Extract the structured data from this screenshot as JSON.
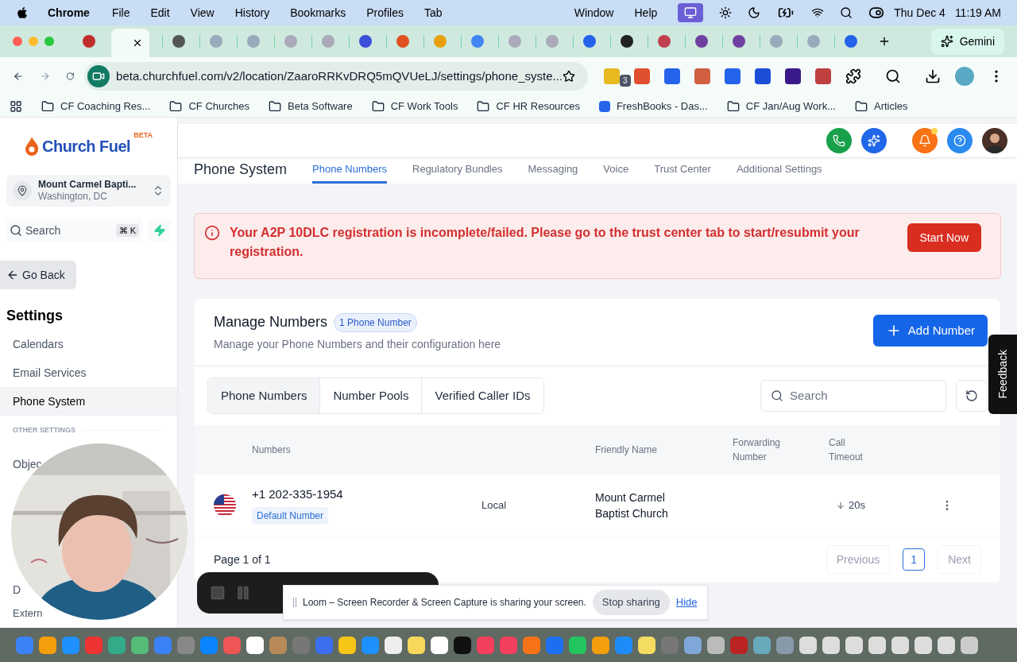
{
  "menu_bar": {
    "app": "Chrome",
    "menus": [
      "File",
      "Edit",
      "View",
      "History",
      "Bookmarks",
      "Profiles",
      "Tab"
    ],
    "right_menus": [
      "Window",
      "Help"
    ],
    "date": "Thu Dec 4",
    "time": "11:19 AM"
  },
  "browser": {
    "gemini": "Gemini",
    "url": "beta.churchfuel.com/v2/location/ZaaroRRKvDRQ5mQVUeLJ/settings/phone_syste...",
    "extension_badge": "3",
    "bookmarks": [
      {
        "label": "CF Coaching Res...",
        "kind": "folder"
      },
      {
        "label": "CF Churches",
        "kind": "folder"
      },
      {
        "label": "Beta Software",
        "kind": "folder"
      },
      {
        "label": "CF Work Tools",
        "kind": "folder"
      },
      {
        "label": "CF HR Resources",
        "kind": "folder"
      },
      {
        "label": "FreshBooks - Das...",
        "kind": "site"
      },
      {
        "label": "CF Jan/Aug Work...",
        "kind": "folder"
      },
      {
        "label": "Articles",
        "kind": "folder"
      }
    ]
  },
  "sidebar": {
    "logo": "Church Fuel",
    "logo_tag": "BETA",
    "location": {
      "name": "Mount Carmel Bapti...",
      "city": "Washington, DC"
    },
    "search": {
      "placeholder": "Search",
      "shortcut": "⌘ K"
    },
    "go_back": "Go Back",
    "heading": "Settings",
    "items": [
      {
        "label": "Calendars",
        "selected": false
      },
      {
        "label": "Email Services",
        "selected": false
      },
      {
        "label": "Phone System",
        "selected": true
      }
    ],
    "section": "OTHER SETTINGS",
    "other_items": [
      "Objec",
      "D",
      "Extern"
    ]
  },
  "page": {
    "title": "Phone System",
    "tabs": [
      {
        "label": "Phone Numbers",
        "selected": true
      },
      {
        "label": "Regulatory Bundles",
        "selected": false
      },
      {
        "label": "Messaging",
        "selected": false
      },
      {
        "label": "Voice",
        "selected": false
      },
      {
        "label": "Trust Center",
        "selected": false
      },
      {
        "label": "Additional Settings",
        "selected": false
      }
    ],
    "alert": {
      "message": "Your A2P 10DLC registration is incomplete/failed. Please go to the trust center tab to start/resubmit your registration.",
      "action": "Start Now"
    },
    "card": {
      "title": "Manage Numbers",
      "count": "1 Phone Number",
      "subtitle": "Manage your Phone Numbers and their configuration here",
      "add_button": "Add Number",
      "segments": [
        {
          "label": "Phone Numbers",
          "selected": true
        },
        {
          "label": "Number Pools",
          "selected": false
        },
        {
          "label": "Verified Caller IDs",
          "selected": false
        }
      ],
      "search": {
        "placeholder": "Search"
      },
      "columns": [
        "Numbers",
        "Friendly Name",
        "Forwarding Number",
        "Call Timeout"
      ],
      "rows": [
        {
          "number": "+1 202-335-1954",
          "badge": "Default Number",
          "type": "Local",
          "friendly_name": "Mount Carmel Baptist Church",
          "timeout": "20s"
        }
      ],
      "pagination": {
        "summary": "Page 1 of 1",
        "previous": {
          "label": "Previous",
          "disabled": true
        },
        "pages": [
          {
            "label": "1",
            "selected": true
          }
        ],
        "next": {
          "label": "Next",
          "disabled": true
        }
      }
    }
  },
  "feedback": "Feedback",
  "loom": {
    "message": "Loom – Screen Recorder & Screen Capture is sharing your screen.",
    "stop": "Stop sharing",
    "hide": "Hide"
  }
}
